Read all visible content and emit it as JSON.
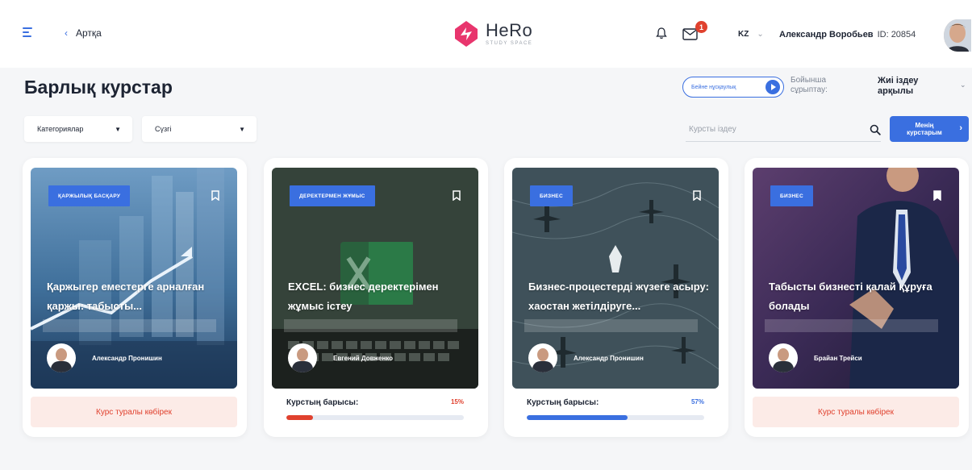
{
  "nav": {
    "back_label": "Артқа"
  },
  "logo": {
    "title": "HeRo",
    "subtitle": "STUDY SPACE"
  },
  "notifications": {
    "mail_count": "1"
  },
  "language": {
    "code": "KZ"
  },
  "user": {
    "name": "Александр Воробьев",
    "id_label": "ID: 20854"
  },
  "page": {
    "title": "Барлық курстар"
  },
  "video_guide": {
    "label": "Бейне нұсқаулық"
  },
  "sort": {
    "label": "Бойынша сұрыптау:",
    "value": "Жиі іздеу арқылы"
  },
  "filters": {
    "categories": "Категориялар",
    "filter": "Сүзгі"
  },
  "search": {
    "placeholder": "Курсты іздеу"
  },
  "my_courses": {
    "label": "Менің курстарым"
  },
  "colors": {
    "accent": "#3a6fe0",
    "danger": "#e0412e",
    "more_bg": "#fcebe7"
  },
  "courses": [
    {
      "category": "ҚАРЖЫЛЫҚ БАСҚАРУ",
      "title": "Қаржыгер еместерге арналған қаржы: табысты...",
      "author": "Александр Пронишин",
      "bookmarked": false,
      "action": "Курс туралы көбірек"
    },
    {
      "category": "ДЕРЕКТЕРМЕН ЖҰМЫС",
      "title": "EXCEL: бизнес деректерімен жұмыс істеу",
      "author": "Евгений Довженко",
      "bookmarked": false,
      "progress_label": "Курстың барысы:",
      "progress_text": "15%",
      "progress": 0.15
    },
    {
      "category": "БИЗНЕС",
      "title": "Бизнес-процестерді жүзеге асыру: хаостан жетілдіруге...",
      "author": "Александр Пронишин",
      "bookmarked": false,
      "progress_label": "Курстың барысы:",
      "progress_text": "57%",
      "progress": 0.57
    },
    {
      "category": "БИЗНЕС",
      "title": "Табысты бизнесті қалай құруға болады",
      "author": "Брайан Трейси",
      "bookmarked": true,
      "action": "Курс туралы көбірек"
    }
  ]
}
